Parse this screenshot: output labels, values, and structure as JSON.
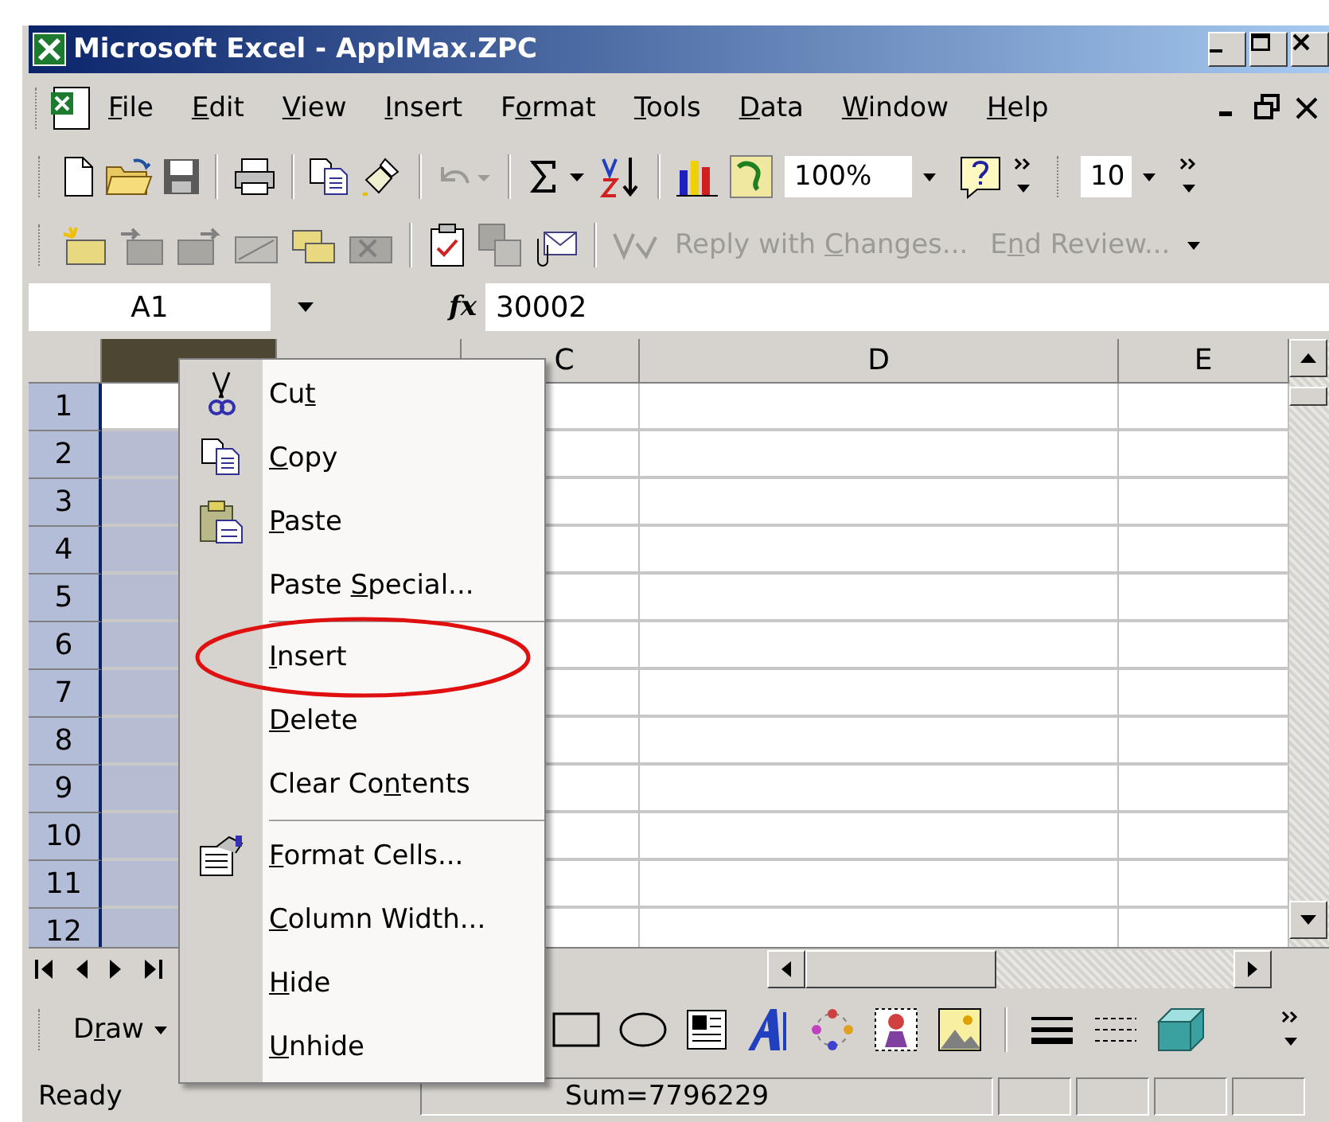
{
  "window": {
    "title": "Microsoft Excel - ApplMax.ZPC"
  },
  "menu_bar": [
    {
      "label": {
        "key": "F",
        "after": "ile"
      }
    },
    {
      "label": {
        "key": "E",
        "after": "dit"
      }
    },
    {
      "label": {
        "key": "V",
        "after": "iew"
      }
    },
    {
      "label": {
        "key": "I",
        "after": "nsert"
      }
    },
    {
      "label": {
        "before": "F",
        "key": "o",
        "after": "rmat"
      }
    },
    {
      "label": {
        "key": "T",
        "after": "ools"
      }
    },
    {
      "label": {
        "key": "D",
        "after": "ata"
      }
    },
    {
      "label": {
        "key": "W",
        "after": "indow"
      }
    },
    {
      "label": {
        "key": "H",
        "after": "elp"
      }
    }
  ],
  "standard_toolbar": {
    "zoom": "100%",
    "font_size": "10"
  },
  "reviewing_toolbar": {
    "buttons": [
      {
        "label": {
          "before": "Reply with ",
          "key": "C",
          "after": "hanges..."
        },
        "disabled": true
      },
      {
        "label": {
          "before": "E",
          "key": "n",
          "after": "d Review..."
        },
        "disabled": true
      }
    ]
  },
  "formula_bar": {
    "name_box": "A1",
    "function_label": "fx",
    "value": "30002"
  },
  "columns": [
    {
      "selected": true
    },
    {
      "selected": false
    },
    {
      "label": "C",
      "selected": false
    },
    {
      "label": "D",
      "selected": false
    },
    {
      "label": "E",
      "selected": false
    }
  ],
  "rows": [
    {
      "label": "1",
      "selected": true
    },
    {
      "label": "2",
      "selected": true
    },
    {
      "label": "3",
      "selected": true
    },
    {
      "label": "4",
      "selected": true
    },
    {
      "label": "5",
      "selected": true
    },
    {
      "label": "6",
      "selected": true
    },
    {
      "label": "7",
      "selected": true
    },
    {
      "label": "8",
      "selected": true
    },
    {
      "label": "9",
      "selected": true
    },
    {
      "label": "10",
      "selected": true
    },
    {
      "label": "11",
      "selected": true
    },
    {
      "label": "12",
      "selected": true
    }
  ],
  "drawing_toolbar": {
    "draw_menu": {
      "before": "D",
      "key": "r",
      "after": "aw"
    }
  },
  "status_bar": {
    "mode": "Ready",
    "sum": "Sum=7796229"
  },
  "context_menu": [
    {
      "kind": "command",
      "label": {
        "before": "Cu",
        "key": "t"
      },
      "circled": false
    },
    {
      "kind": "command",
      "label": {
        "key": "C",
        "after": "opy"
      },
      "circled": false
    },
    {
      "kind": "command",
      "label": {
        "key": "P",
        "after": "aste"
      },
      "circled": false
    },
    {
      "kind": "command",
      "label": {
        "before": "Paste ",
        "key": "S",
        "after": "pecial..."
      },
      "circled": false
    },
    {
      "kind": "separator"
    },
    {
      "kind": "command",
      "label": {
        "key": "I",
        "after": "nsert"
      },
      "circled": true
    },
    {
      "kind": "command",
      "label": {
        "key": "D",
        "after": "elete"
      },
      "circled": false
    },
    {
      "kind": "command",
      "label": {
        "before": "Clear Co",
        "key": "n",
        "after": "tents"
      },
      "circled": false
    },
    {
      "kind": "separator"
    },
    {
      "kind": "command",
      "label": {
        "key": "F",
        "after": "ormat Cells..."
      },
      "circled": false
    },
    {
      "kind": "command",
      "label": {
        "key": "C",
        "after": "olumn Width..."
      },
      "circled": false
    },
    {
      "kind": "command",
      "label": {
        "key": "H",
        "after": "ide"
      },
      "circled": false
    },
    {
      "kind": "command",
      "label": {
        "key": "U",
        "after": "nhide"
      },
      "circled": false
    }
  ]
}
